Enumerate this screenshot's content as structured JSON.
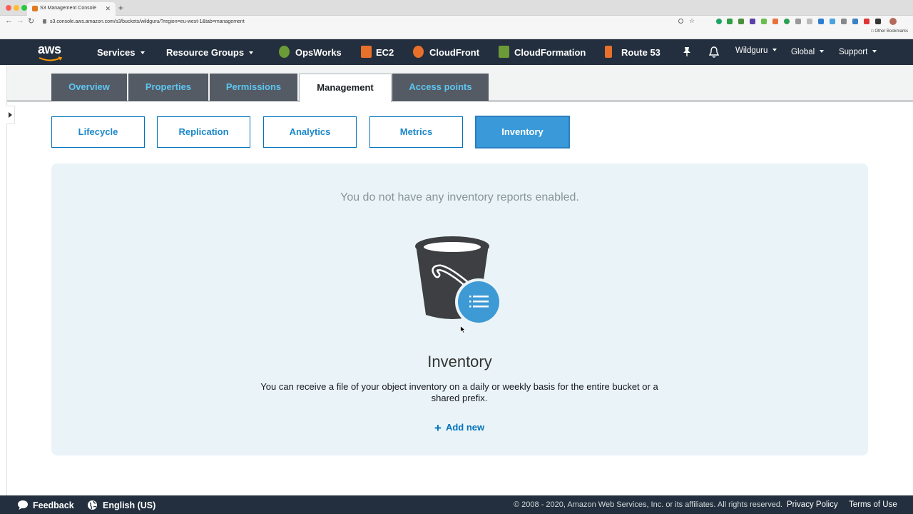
{
  "browser": {
    "tab_title": "S3 Management Console",
    "new_tab": "+",
    "tab_close": "✕",
    "url": "s3.console.aws.amazon.com/s3/buckets/wildguru/?region=eu-west-1&tab=management",
    "bookmarks": "Other Bookmarks"
  },
  "aws_nav": {
    "logo": "aws",
    "services": "Services",
    "resource_groups": "Resource Groups",
    "shortcuts": [
      "OpsWorks",
      "EC2",
      "CloudFront",
      "CloudFormation",
      "Route 53"
    ],
    "account": "Wildguru",
    "region": "Global",
    "support": "Support"
  },
  "tabs": [
    "Overview",
    "Properties",
    "Permissions",
    "Management",
    "Access points"
  ],
  "active_tab": "Management",
  "subtabs": [
    "Lifecycle",
    "Replication",
    "Analytics",
    "Metrics",
    "Inventory"
  ],
  "active_subtab": "Inventory",
  "panel": {
    "empty_message": "You do not have any inventory reports enabled.",
    "title": "Inventory",
    "description": "You can receive a file of your object inventory on a daily or weekly basis for the entire bucket or a shared prefix.",
    "add_icon": "+",
    "add_label": "Add new"
  },
  "footer": {
    "feedback": "Feedback",
    "language": "English (US)",
    "copyright": "© 2008 - 2020, Amazon Web Services, Inc. or its affiliates. All rights reserved.",
    "privacy": "Privacy Policy",
    "terms": "Terms of Use"
  },
  "colors": {
    "nav_bg": "#232f3e",
    "tab_bg": "#545b64",
    "tab_text": "#5ec6f2",
    "link": "#0073bb",
    "active_subtab": "#3a9ad9",
    "panel_bg": "#eaf4f8"
  }
}
